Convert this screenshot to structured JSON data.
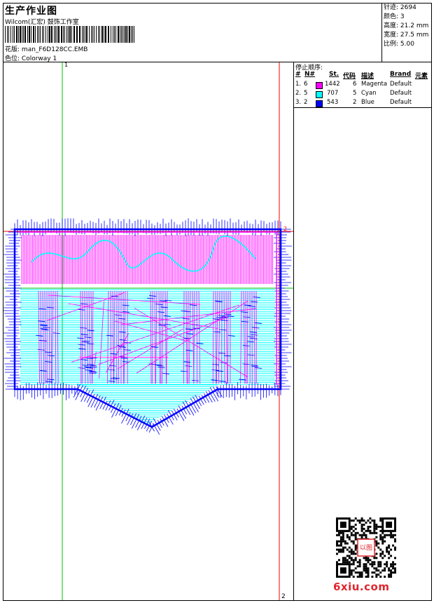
{
  "header": {
    "title": "生产作业图",
    "company": "Wilcom(汇宏) 鼓饰工作室",
    "design_label": "花版:",
    "design_value": "man_F6D128CC.EMB",
    "colorway_label": "色位:",
    "colorway_value": "Colorway 1"
  },
  "stats": [
    {
      "label": "针迹:",
      "value": "2694"
    },
    {
      "label": "颜色:",
      "value": "3"
    },
    {
      "label": "高度:",
      "value": "21.2 mm"
    },
    {
      "label": "宽度:",
      "value": "27.5 mm"
    },
    {
      "label": "比例:",
      "value": "5.00"
    }
  ],
  "canvas": {
    "guide_top_label": "1",
    "guide_marker_2": "2",
    "guide_bottom_label": "2"
  },
  "stop_sequence": {
    "title": "停止顺序:",
    "columns": {
      "num": "#",
      "n": "N#",
      "st": "St.",
      "code": "代码",
      "desc": "描述",
      "brand": "Brand",
      "elem": "元素"
    },
    "rows": [
      {
        "num": "1.",
        "n": "6",
        "color": "#ff00ff",
        "st": "1442",
        "code": "6",
        "desc": "Magenta",
        "brand": "Default"
      },
      {
        "num": "2.",
        "n": "5",
        "color": "#00ffff",
        "st": "707",
        "code": "5",
        "desc": "Cyan",
        "brand": "Default"
      },
      {
        "num": "3.",
        "n": "2",
        "color": "#0000ff",
        "st": "543",
        "code": "2",
        "desc": "Blue",
        "brand": "Default"
      }
    ]
  },
  "footer": {
    "brand": "6xiu.com",
    "stamp_text": "以图"
  },
  "colors": {
    "magenta": "#ff00ff",
    "cyan": "#00ffff",
    "blue": "#0000ff",
    "guide_green": "#00c000",
    "guide_red": "#ff0000",
    "brand_red": "#e0262e"
  }
}
